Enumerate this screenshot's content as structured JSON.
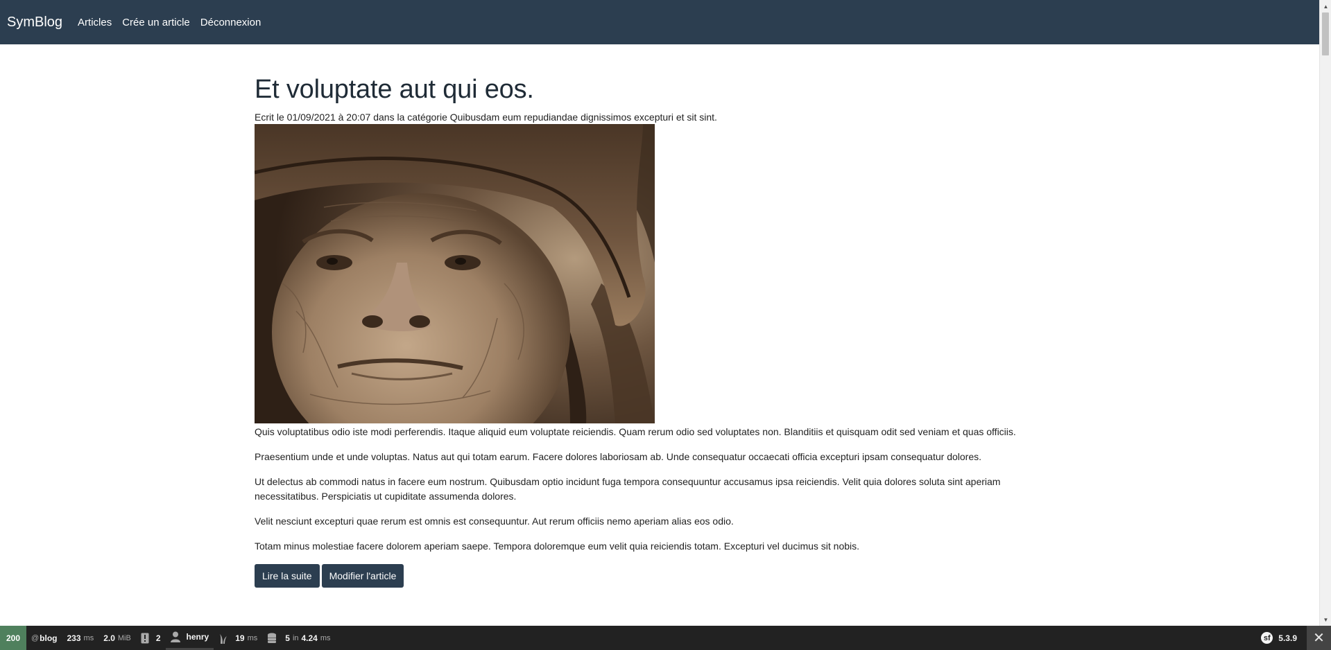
{
  "navbar": {
    "brand": "SymBlog",
    "links": [
      "Articles",
      "Crée un article",
      "Déconnexion"
    ]
  },
  "article": {
    "title": "Et voluptate aut qui eos.",
    "meta": "Ecrit le 01/09/2021 à 20:07 dans la catégorie Quibusdam eum repudiandae dignissimos excepturi et sit sint.",
    "image_alt": "Portrait photo of an elderly person wearing a bucket hat (sepia)",
    "paragraphs": [
      "Quis voluptatibus odio iste modi perferendis. Itaque aliquid eum voluptate reiciendis. Quam rerum odio sed voluptates non. Blanditiis et quisquam odit sed veniam et quas officiis.",
      "Praesentium unde et unde voluptas. Natus aut qui totam earum. Facere dolores laboriosam ab. Unde consequatur occaecati officia excepturi ipsam consequatur dolores.",
      "Ut delectus ab commodi natus in facere eum nostrum. Quibusdam optio incidunt fuga tempora consequuntur accusamus ipsa reiciendis. Velit quia dolores soluta sint aperiam necessitatibus. Perspiciatis ut cupiditate assumenda dolores.",
      "Velit nesciunt excepturi quae rerum est omnis est consequuntur. Aut rerum officiis nemo aperiam alias eos odio.",
      "Totam minus molestiae facere dolorem aperiam saepe. Tempora doloremque eum velit quia reiciendis totam. Excepturi vel ducimus sit nobis."
    ],
    "buttons": {
      "read_more": "Lire la suite",
      "edit": "Modifier l'article"
    }
  },
  "colors": {
    "navbar_bg": "#2c3e50",
    "button_bg": "#2c3e50",
    "toolbar_bg": "#222222",
    "status_ok": "#4f805d"
  },
  "debug_toolbar": {
    "status_code": "200",
    "route_prefix": "@",
    "route": "blog",
    "time_value": "233",
    "time_unit": "ms",
    "memory_value": "2.0",
    "memory_unit": "MiB",
    "logs_count": "2",
    "user": "henry",
    "twig_value": "19",
    "twig_unit": "ms",
    "db_queries": "5",
    "db_in": "in",
    "db_time_value": "4.24",
    "db_time_unit": "ms",
    "symfony_version": "5.3.9",
    "icons": [
      "logs-icon",
      "user-icon",
      "twig-icon",
      "database-icon",
      "symfony-logo-icon",
      "close-icon"
    ]
  }
}
